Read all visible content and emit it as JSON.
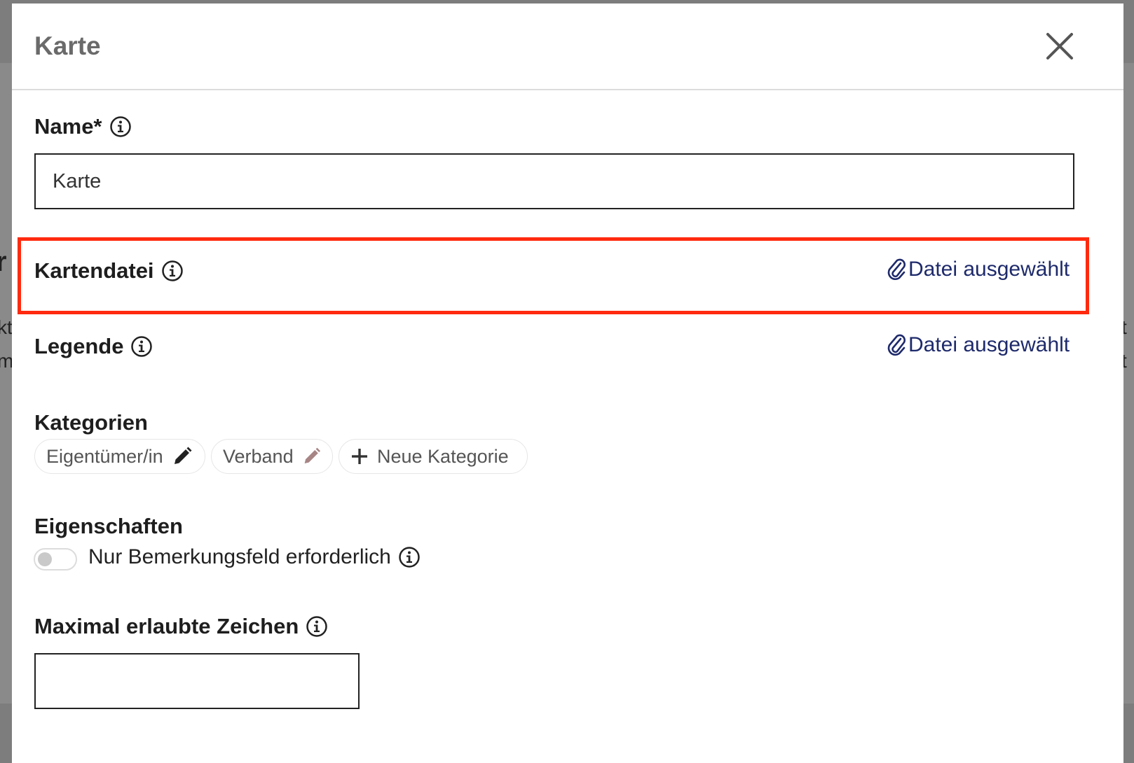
{
  "background": {
    "text1": "r",
    "text2": "kt",
    "text3": "m",
    "text4": "t",
    "text5": "t"
  },
  "modal": {
    "title": "Karte",
    "close_icon": "close-icon"
  },
  "name_field": {
    "label": "Name*",
    "value": "Karte",
    "info_icon": "info-icon"
  },
  "kartendatei": {
    "label": "Kartendatei",
    "file_link": "Datei ausgewählt",
    "icon": "paperclip-icon"
  },
  "legende": {
    "label": "Legende",
    "file_link": "Datei ausgewählt",
    "icon": "paperclip-icon"
  },
  "kategorien": {
    "label": "Kategorien",
    "chips": [
      {
        "label": "Eigentümer/in",
        "icon": "pencil-icon"
      },
      {
        "label": "Verband",
        "icon": "pencil-icon"
      }
    ],
    "add_label": "Neue Kategorie",
    "add_icon": "plus-icon"
  },
  "eigenschaften": {
    "label": "Eigenschaften",
    "toggle_label": "Nur Bemerkungsfeld erforderlich",
    "toggle_on": false
  },
  "max_chars": {
    "label": "Maximal erlaubte Zeichen",
    "value": ""
  },
  "colors": {
    "accent_link": "#1e2a6b",
    "highlight": "#ff2a0f",
    "pencil_active": "#222222",
    "pencil_muted": "#a88585"
  }
}
